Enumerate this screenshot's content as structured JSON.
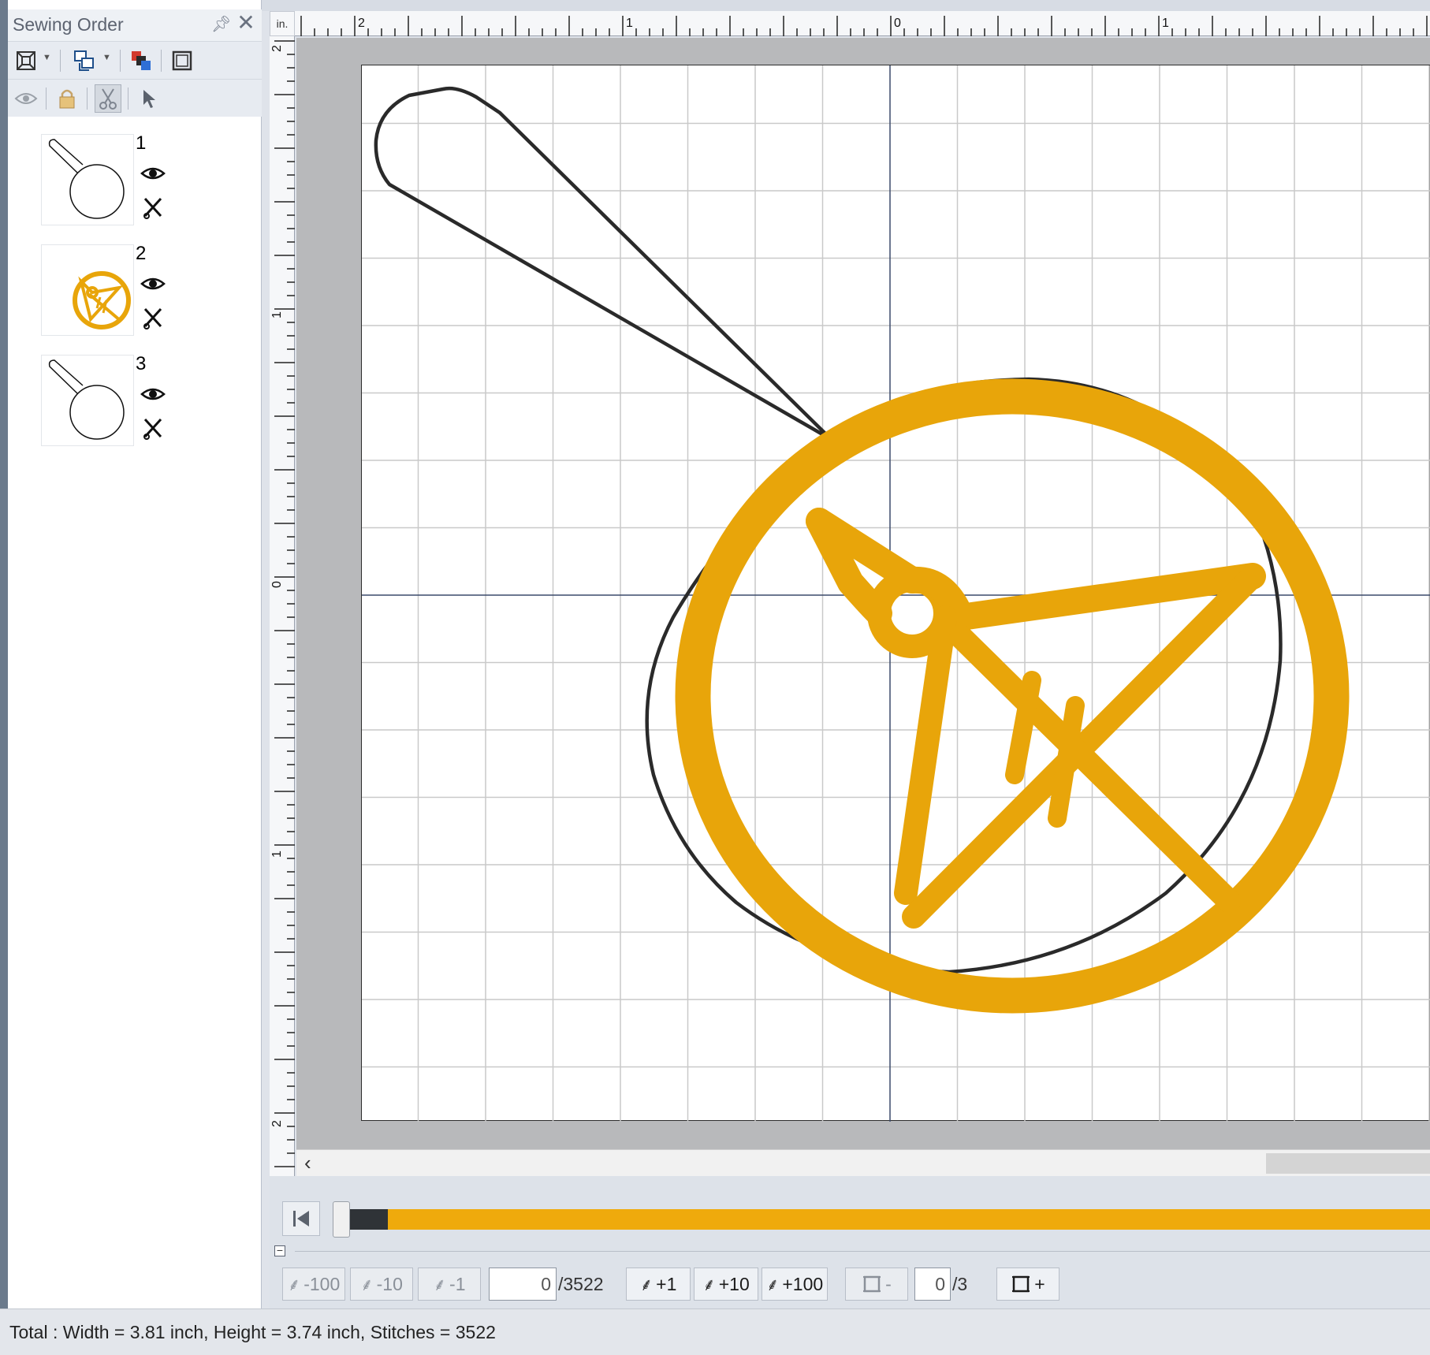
{
  "panel": {
    "title": "Sewing Order",
    "items": [
      {
        "number": "1",
        "thumbnail": "outline-frame"
      },
      {
        "number": "2",
        "thumbnail": "gold-emblem"
      },
      {
        "number": "3",
        "thumbnail": "outline-frame"
      }
    ]
  },
  "ruler": {
    "unit": "in.",
    "top_labels": [
      "2",
      "1",
      "0",
      "1"
    ],
    "left_labels": [
      "2",
      "1",
      "0",
      "1",
      "2"
    ]
  },
  "design": {
    "outline_color": "#2a2a2a",
    "thread_color": "#e8a50a"
  },
  "simulator": {
    "progress": 0.035,
    "track_color": "#efaa0c",
    "back100": "-100",
    "back10": "-10",
    "back1": "-1",
    "stitch_current": "0",
    "stitch_total": "/3522",
    "fwd1": "+1",
    "fwd10": "+10",
    "fwd100": "+100",
    "color_minus": "-",
    "color_current": "0",
    "color_total": "/3",
    "color_plus": "+"
  },
  "status": {
    "text": "Total : Width = 3.81 inch, Height = 3.74 inch, Stitches = 3522"
  }
}
